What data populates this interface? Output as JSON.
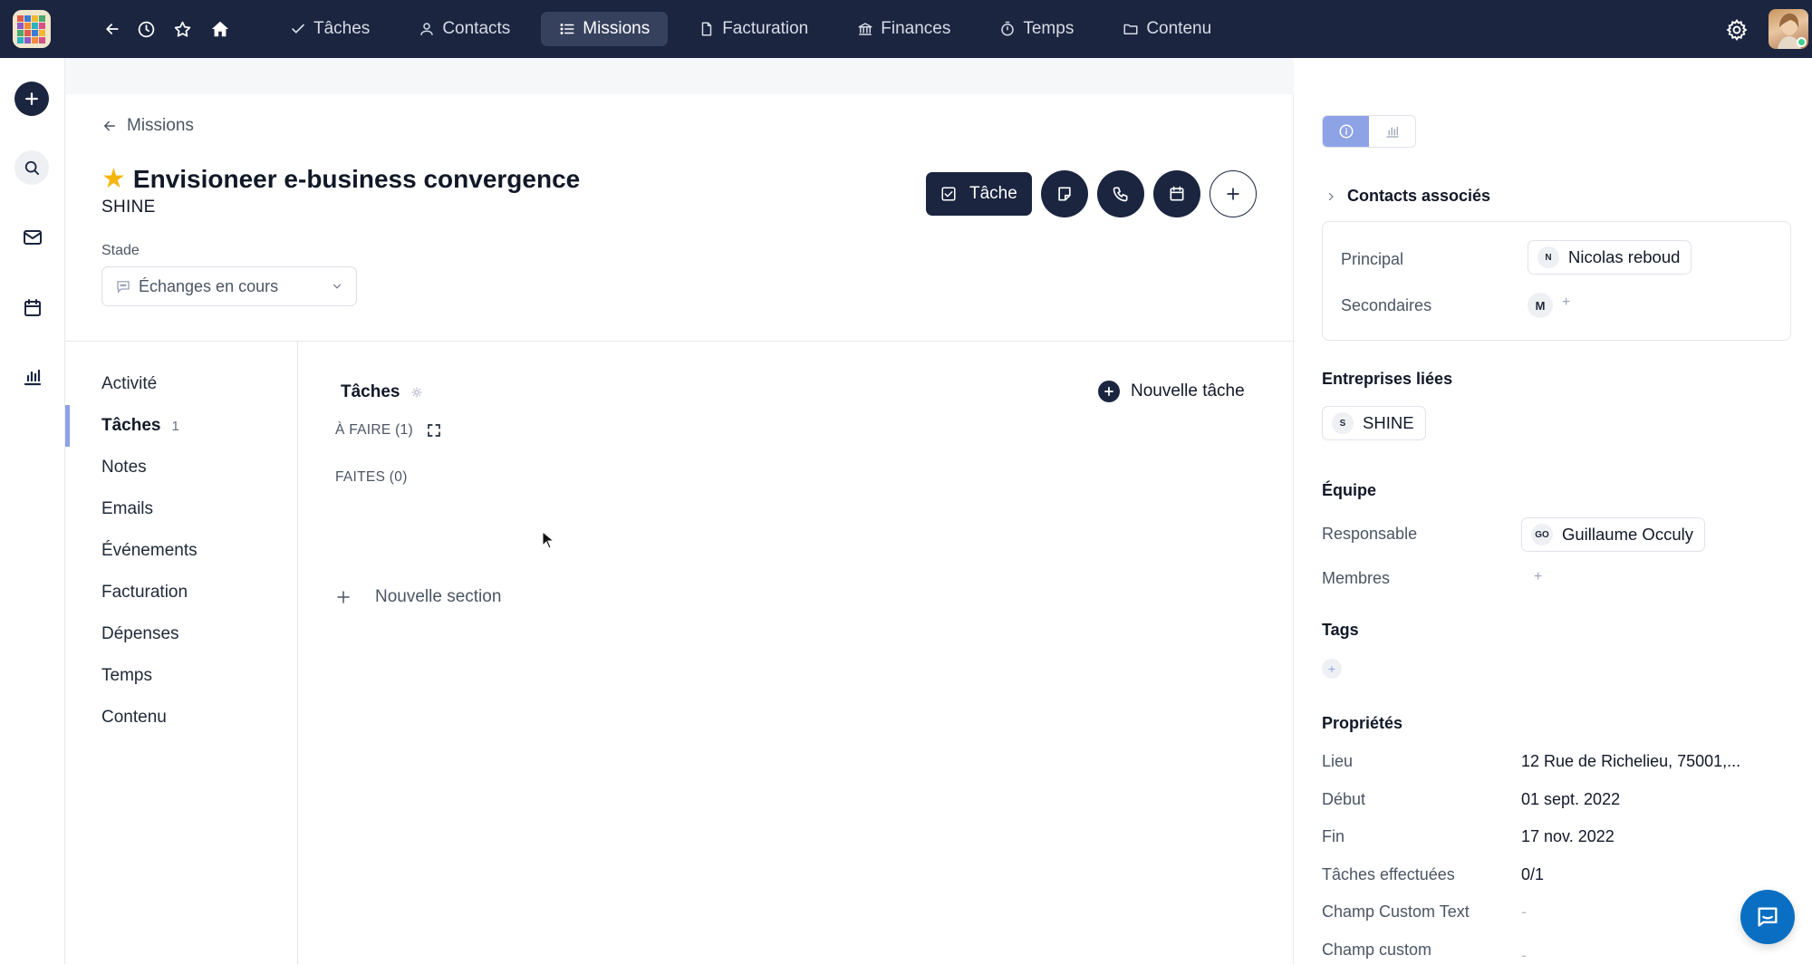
{
  "topnav": {
    "tabs": [
      {
        "label": "Tâches",
        "icon": "check-icon"
      },
      {
        "label": "Contacts",
        "icon": "user-icon"
      },
      {
        "label": "Missions",
        "icon": "list-icon",
        "active": true
      },
      {
        "label": "Facturation",
        "icon": "document-icon"
      },
      {
        "label": "Finances",
        "icon": "bank-icon"
      },
      {
        "label": "Temps",
        "icon": "stopwatch-icon"
      },
      {
        "label": "Contenu",
        "icon": "folder-icon"
      }
    ]
  },
  "header": {
    "back_label": "Missions",
    "title": "Envisioneer e-business convergence",
    "company": "SHINE",
    "stage_label": "Stade",
    "stage_value": "Échanges en cours",
    "task_button": "Tâche"
  },
  "sections": [
    {
      "label": "Activité"
    },
    {
      "label": "Tâches",
      "count": "1",
      "active": true
    },
    {
      "label": "Notes"
    },
    {
      "label": "Emails"
    },
    {
      "label": "Événements"
    },
    {
      "label": "Facturation"
    },
    {
      "label": "Dépenses"
    },
    {
      "label": "Temps"
    },
    {
      "label": "Contenu"
    }
  ],
  "tasks": {
    "heading": "Tâches",
    "new_task": "Nouvelle tâche",
    "todo_group": "À FAIRE (1)",
    "done_group": "FAITES (0)",
    "new_section": "Nouvelle section"
  },
  "panel": {
    "contacts_heading": "Contacts associés",
    "principal_label": "Principal",
    "principal_initial": "N",
    "principal_name": "Nicolas reboud",
    "secondary_label": "Secondaires",
    "secondary_initial": "M",
    "companies_heading": "Entreprises liées",
    "company_initial": "S",
    "company_name": "SHINE",
    "team_heading": "Équipe",
    "responsable_label": "Responsable",
    "responsable_initials": "GO",
    "responsable_name": "Guillaume Occuly",
    "members_label": "Membres",
    "tags_heading": "Tags",
    "props_heading": "Propriétés",
    "properties": [
      {
        "label": "Lieu",
        "value": "12 Rue de Richelieu, 75001,..."
      },
      {
        "label": "Début",
        "value": "01 sept. 2022"
      },
      {
        "label": "Fin",
        "value": "17 nov. 2022"
      },
      {
        "label": "Tâches effectuées",
        "value": "0/1"
      },
      {
        "label": "Champ Custom Text",
        "value": "-"
      },
      {
        "label": "Champ custom",
        "value": "-"
      }
    ]
  },
  "colors": {
    "navy": "#1b2540",
    "accent": "#8ea2e6",
    "chat": "#0a6fc2"
  }
}
